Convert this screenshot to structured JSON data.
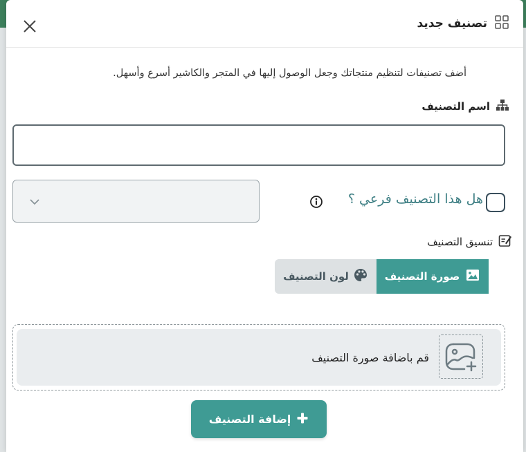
{
  "modal": {
    "title": "تصنيف جديد",
    "description": "أضف تصنيفات لتنظيم منتجاتك وجعل الوصول إليها في المتجر والكاشير أسرع وأسهل.",
    "close_icon": "close-icon",
    "title_icon": "grid-icon"
  },
  "name_field": {
    "label": "اسم التصنيف",
    "icon": "sitemap-icon",
    "value": ""
  },
  "subcategory": {
    "label": "هل هذا التصنيف فرعي ؟",
    "checked": false,
    "info_icon": "info-icon",
    "parent_select_value": ""
  },
  "formatting": {
    "label": "تنسيق التصنيف",
    "icon": "edit-icon",
    "tabs": [
      {
        "label": "صورة التصنيف",
        "icon": "image-icon",
        "active": true
      },
      {
        "label": "لون التصنيف",
        "icon": "palette-icon",
        "active": false
      }
    ]
  },
  "upload": {
    "text": "قم باضافة صورة التصنيف",
    "icon": "add-image-icon"
  },
  "submit": {
    "label": "إضافة التصنيف",
    "icon": "plus-icon"
  },
  "colors": {
    "accent": "#3f9b94",
    "subcategory_label": "#3e7f84",
    "inactive_tab": "#dde1e3"
  }
}
